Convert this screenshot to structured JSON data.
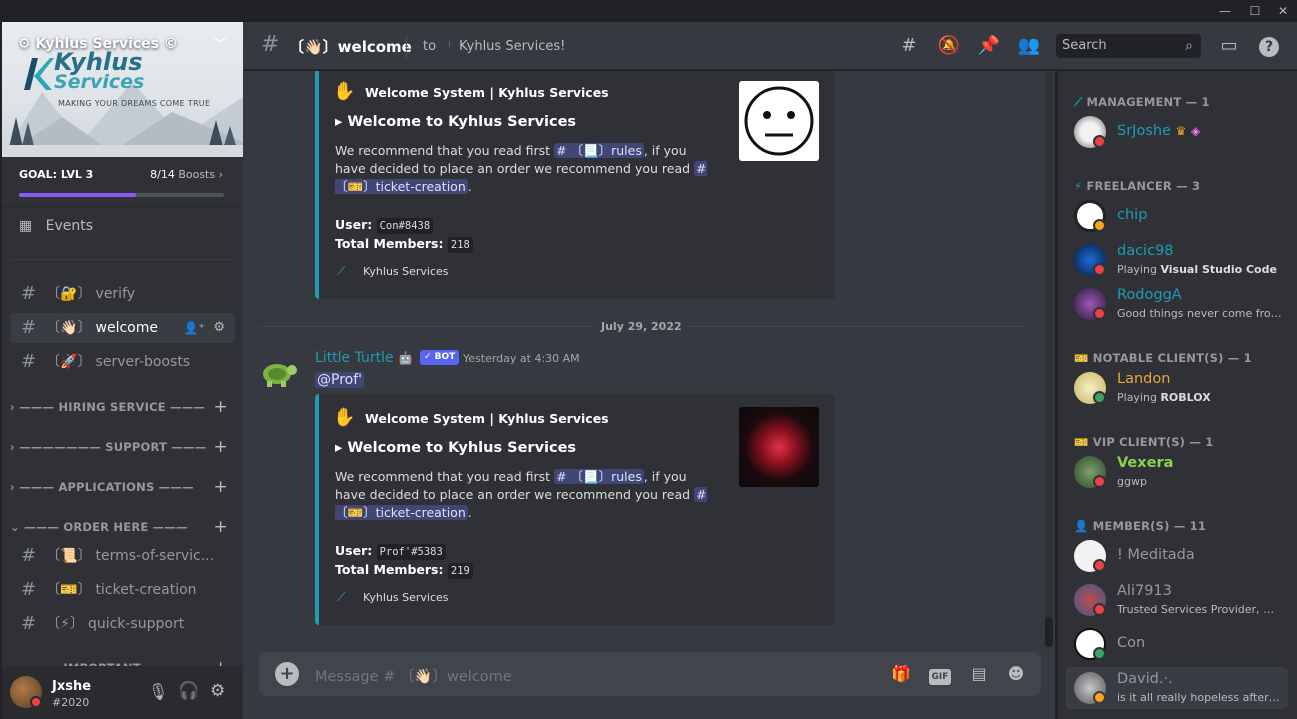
{
  "window": {
    "minimize": "—",
    "maximize": "☐",
    "close": "✕"
  },
  "server": {
    "name": "Kyhlus Services ©",
    "logo_line1": "Kyhlus",
    "logo_line2": "Services",
    "tagline": "MAKING YOUR DREAMS COME TRUE",
    "goal_label": "GOAL: LVL 3",
    "boosts_count": "8/14",
    "boosts_word": "Boosts",
    "goal_progress": 0.57
  },
  "sidebar": {
    "events": "Events",
    "channels_top": [
      {
        "emoji": "🔐",
        "name": "verify"
      },
      {
        "emoji": "👋🏻",
        "name": "welcome"
      },
      {
        "emoji": "🚀",
        "name": "server-boosts"
      }
    ],
    "categories": [
      "HIRING SERVICE",
      "SUPPORT",
      "APPLICATIONS",
      "ORDER HERE"
    ],
    "order_channels": [
      {
        "emoji": "📜",
        "name": "terms-of-servic..."
      },
      {
        "emoji": "🎫",
        "name": "ticket-creation"
      },
      {
        "emoji": "⚡",
        "name": "quick-support"
      }
    ],
    "cut_category": "IMPORTANT"
  },
  "user": {
    "name": "Jxshe",
    "tag": "#2020"
  },
  "header": {
    "channel": "〔👋🏻〕welcome",
    "to_label": "to",
    "topic": "Kyhlus Services!",
    "search_placeholder": "Search"
  },
  "messages": {
    "embed_author": "Welcome System | Kyhlus Services",
    "embed_title": "Welcome to Kyhlus Services",
    "desc_pre": "We recommend that you read first",
    "rules_mention": "〔📃〕rules",
    "desc_mid": ", if you have decided to place an order we recommend you read",
    "ticket_mention": "〔🎫〕ticket-creation",
    "user_label": "User:",
    "members_label": "Total Members:",
    "footer": "Kyhlus Services",
    "embed1_user": "Con#8438",
    "embed1_members": "218",
    "date_divider": "July 29, 2022",
    "bot_name": "Little Turtle",
    "bot_badge": "✓ BOT",
    "timestamp": "Yesterday at 4:30 AM",
    "mention_line": "@Prof'",
    "embed2_user": "Prof'#5383",
    "embed2_members": "219"
  },
  "composer": {
    "placeholder": "Message # 〔👋🏻〕welcome",
    "gif": "GIF"
  },
  "members": {
    "groups": [
      {
        "label": "MANAGEMENT — 1",
        "members": [
          {
            "name": "SrJoshe",
            "color": "#1f9cb3",
            "status": "dnd"
          }
        ]
      },
      {
        "label": "FREELANCER — 3",
        "members": [
          {
            "name": "chip",
            "color": "#1f9cb3",
            "status": "idle"
          },
          {
            "name": "dacic98",
            "color": "#1f9cb3",
            "status": "dnd",
            "activity_pre": "Playing ",
            "activity": "Visual Studio Code"
          },
          {
            "name": "RodoggA",
            "color": "#1f9cb3",
            "status": "dnd",
            "activity_pre": "",
            "activity": "Good things never come from ..."
          }
        ]
      },
      {
        "label": "NOTABLE CLIENT(S) — 1",
        "members": [
          {
            "name": "Landon",
            "color": "#e3a83a",
            "status": "online",
            "activity_pre": "Playing ",
            "activity": "ROBLOX"
          }
        ]
      },
      {
        "label": "VIP CLIENT(S) — 1",
        "members": [
          {
            "name": "Vexera",
            "color": "#8fd14f",
            "status": "dnd",
            "activity_pre": "",
            "activity": "ggwp"
          }
        ]
      },
      {
        "label": "MEMBER(S) — 11",
        "members": [
          {
            "name": "! Meditada",
            "color": "#96989d",
            "status": "dnd"
          },
          {
            "name": "Ali7913",
            "color": "#96989d",
            "status": "dnd",
            "activity_pre": "",
            "activity": "Trusted Services Provider, Hig..."
          },
          {
            "name": "Con",
            "color": "#96989d",
            "status": "online"
          },
          {
            "name": "David.·.",
            "color": "#96989d",
            "status": "idle",
            "activity_pre": "",
            "activity": "is it all really hopeless afterall?"
          }
        ]
      }
    ]
  }
}
